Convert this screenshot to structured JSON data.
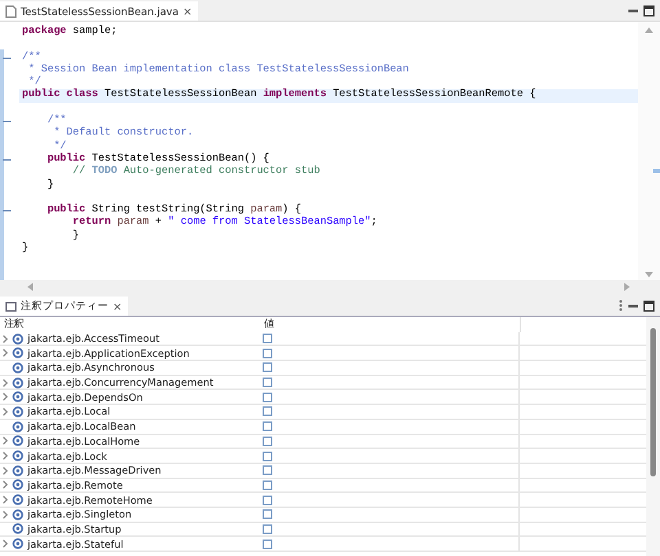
{
  "editor": {
    "tab": {
      "label": "TestStatelessSessionBean.java",
      "close": "×",
      "selected": true
    },
    "lines": [
      {
        "tokens": [
          {
            "kind": "keyword",
            "text": "package"
          },
          {
            "kind": "plain",
            "text": " sample;"
          }
        ]
      },
      {
        "gap_before": true,
        "fold": true,
        "tokens": [
          {
            "kind": "doc",
            "text": "/**"
          }
        ]
      },
      {
        "tokens": [
          {
            "kind": "doc",
            "text": " * Session Bean implementation class TestStatelessSessionBean"
          }
        ]
      },
      {
        "tokens": [
          {
            "kind": "doc",
            "text": " */"
          }
        ]
      },
      {
        "current": true,
        "tokens": [
          {
            "kind": "keyword",
            "text": "public class"
          },
          {
            "kind": "plain",
            "text": " TestStatelessSessionBean "
          },
          {
            "kind": "keyword",
            "text": "implements"
          },
          {
            "kind": "plain",
            "text": " TestStatelessSessionBeanRemote {"
          }
        ]
      },
      {
        "gap_before": true,
        "fold": true,
        "tokens": [
          {
            "kind": "doc",
            "text": "    /**"
          }
        ]
      },
      {
        "tokens": [
          {
            "kind": "doc",
            "text": "     * Default constructor."
          }
        ]
      },
      {
        "tokens": [
          {
            "kind": "doc",
            "text": "     */"
          }
        ]
      },
      {
        "fold": true,
        "tokens": [
          {
            "kind": "keyword",
            "text": "    public"
          },
          {
            "kind": "plain",
            "text": " TestStatelessSessionBean() {"
          }
        ]
      },
      {
        "tokens": [
          {
            "kind": "comment",
            "text": "        // "
          },
          {
            "kind": "todo",
            "text": "TODO"
          },
          {
            "kind": "comment",
            "text": " Auto-generated constructor stub"
          }
        ]
      },
      {
        "tokens": [
          {
            "kind": "plain",
            "text": "    }"
          }
        ]
      },
      {
        "gap_before": true,
        "fold": true,
        "tokens": [
          {
            "kind": "keyword",
            "text": "    public"
          },
          {
            "kind": "plain",
            "text": " String testString(String "
          },
          {
            "kind": "param",
            "text": "param"
          },
          {
            "kind": "plain",
            "text": ") {"
          }
        ]
      },
      {
        "tokens": [
          {
            "kind": "keyword",
            "text": "        return"
          },
          {
            "kind": "param",
            "text": " param"
          },
          {
            "kind": "plain",
            "text": " + "
          },
          {
            "kind": "string",
            "text": "\" come from StatelessBeanSample\""
          },
          {
            "kind": "plain",
            "text": ";"
          }
        ]
      },
      {
        "tokens": [
          {
            "kind": "plain",
            "text": "        }"
          }
        ]
      },
      {
        "tokens": [
          {
            "kind": "plain",
            "text": "}"
          }
        ]
      }
    ]
  },
  "panel": {
    "tab": {
      "label": "注釈プロパティー",
      "close": "×",
      "selected": true
    },
    "columns": [
      "注釈",
      "値"
    ],
    "rows": [
      {
        "name": "jakarta.ejb.AccessTimeout",
        "expandable": true,
        "checked": false
      },
      {
        "name": "jakarta.ejb.ApplicationException",
        "expandable": true,
        "checked": false
      },
      {
        "name": "jakarta.ejb.Asynchronous",
        "expandable": false,
        "checked": false
      },
      {
        "name": "jakarta.ejb.ConcurrencyManagement",
        "expandable": true,
        "checked": false
      },
      {
        "name": "jakarta.ejb.DependsOn",
        "expandable": true,
        "checked": false
      },
      {
        "name": "jakarta.ejb.Local",
        "expandable": true,
        "checked": false
      },
      {
        "name": "jakarta.ejb.LocalBean",
        "expandable": false,
        "checked": false
      },
      {
        "name": "jakarta.ejb.LocalHome",
        "expandable": true,
        "checked": false
      },
      {
        "name": "jakarta.ejb.Lock",
        "expandable": true,
        "checked": false
      },
      {
        "name": "jakarta.ejb.MessageDriven",
        "expandable": true,
        "checked": false
      },
      {
        "name": "jakarta.ejb.Remote",
        "expandable": true,
        "checked": false
      },
      {
        "name": "jakarta.ejb.RemoteHome",
        "expandable": true,
        "checked": false
      },
      {
        "name": "jakarta.ejb.Singleton",
        "expandable": true,
        "checked": false
      },
      {
        "name": "jakarta.ejb.Startup",
        "expandable": false,
        "checked": false
      },
      {
        "name": "jakarta.ejb.Stateful",
        "expandable": true,
        "checked": false
      }
    ]
  }
}
